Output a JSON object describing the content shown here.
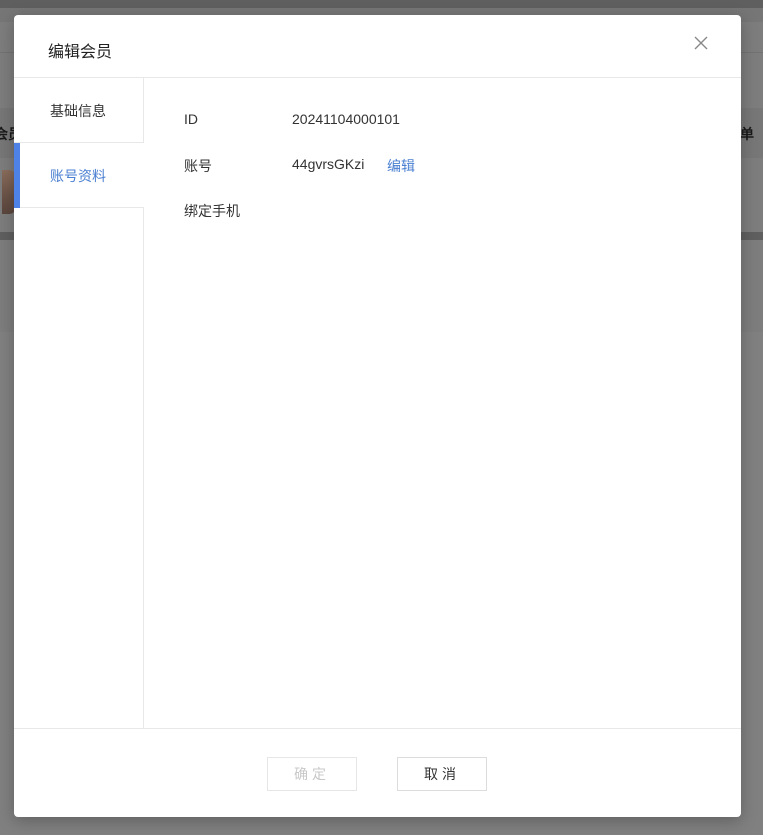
{
  "background": {
    "left_cut_text": "会员",
    "right_cut_text": "单"
  },
  "modal": {
    "title": "编辑会员",
    "close_icon": "close-icon",
    "nav": [
      {
        "label": "基础信息",
        "active": false
      },
      {
        "label": "账号资料",
        "active": true
      }
    ],
    "fields": {
      "id_label": "ID",
      "id_value": "20241104000101",
      "account_label": "账号",
      "account_value": "44gvrsGKzi",
      "account_edit": "编辑",
      "phone_label": "绑定手机",
      "phone_value": ""
    },
    "footer": {
      "confirm_label": "确定",
      "cancel_label": "取消"
    }
  },
  "colors": {
    "accent": "#4e82e6",
    "link": "#4a7fd1",
    "overlay": "#808080"
  }
}
